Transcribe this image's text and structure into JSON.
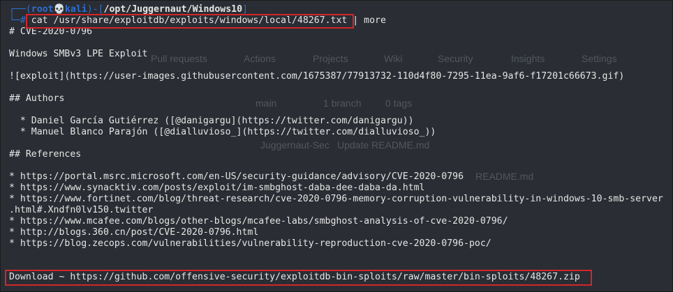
{
  "prompt": {
    "open": "┌──(",
    "user": "root💀kali",
    "mid": ")-[",
    "path": "/opt/Juggernaut/Windows10",
    "close": "]",
    "prefix": "└─#",
    "command": "cat /usr/share/exploitdb/exploits/windows/local/48267.txt",
    "pipe": "| more"
  },
  "output": [
    "# CVE-2020-0796",
    "",
    "Windows SMBv3 LPE Exploit",
    "",
    "![exploit](https://user-images.githubusercontent.com/1675387/77913732-110d4f80-7295-11ea-9af6-f17201c66673.gif)",
    "",
    "## Authors",
    "",
    "  * Daniel García Gutiérrez ([@danigargu](https://twitter.com/danigargu))",
    "  * Manuel Blanco Parajón ([@dialluvioso_](https://twitter.com/dialluvioso_))",
    "",
    "## References",
    "",
    "* https://portal.msrc.microsoft.com/en-US/security-guidance/advisory/CVE-2020-0796",
    "* https://www.synacktiv.com/posts/exploit/im-smbghost-daba-dee-daba-da.html",
    "* https://www.fortinet.com/blog/threat-research/cve-2020-0796-memory-corruption-vulnerability-in-windows-10-smb-server",
    ".html#.Xndfn0lv150.twitter",
    "* https://www.mcafee.com/blogs/other-blogs/mcafee-labs/smbghost-analysis-of-cve-2020-0796/",
    "* http://blogs.360.cn/post/CVE-2020-0796.html",
    "* https://blog.zecops.com/vulnerabilities/vulnerability-reproduction-cve-2020-0796-poc/",
    "",
    "",
    "Download ~ https://github.com/offensive-security/exploitdb-bin-sploits/raw/master/bin-sploits/48267.zip"
  ],
  "background": {
    "tabs": [
      "Pull requests",
      "Actions",
      "Projects",
      "Wiki",
      "Security",
      "Insights",
      "Settings"
    ],
    "branch": "main",
    "branch_count": "1 branch",
    "tags": "0 tags",
    "commit_author": "Juggernaut-Sec",
    "commit_message": "Update README.md",
    "file": "README.md"
  },
  "colors": {
    "background": "#2a2d33",
    "text": "#e6e6e6",
    "prompt": "#2f6fd0",
    "highlight": "#d3262b"
  }
}
